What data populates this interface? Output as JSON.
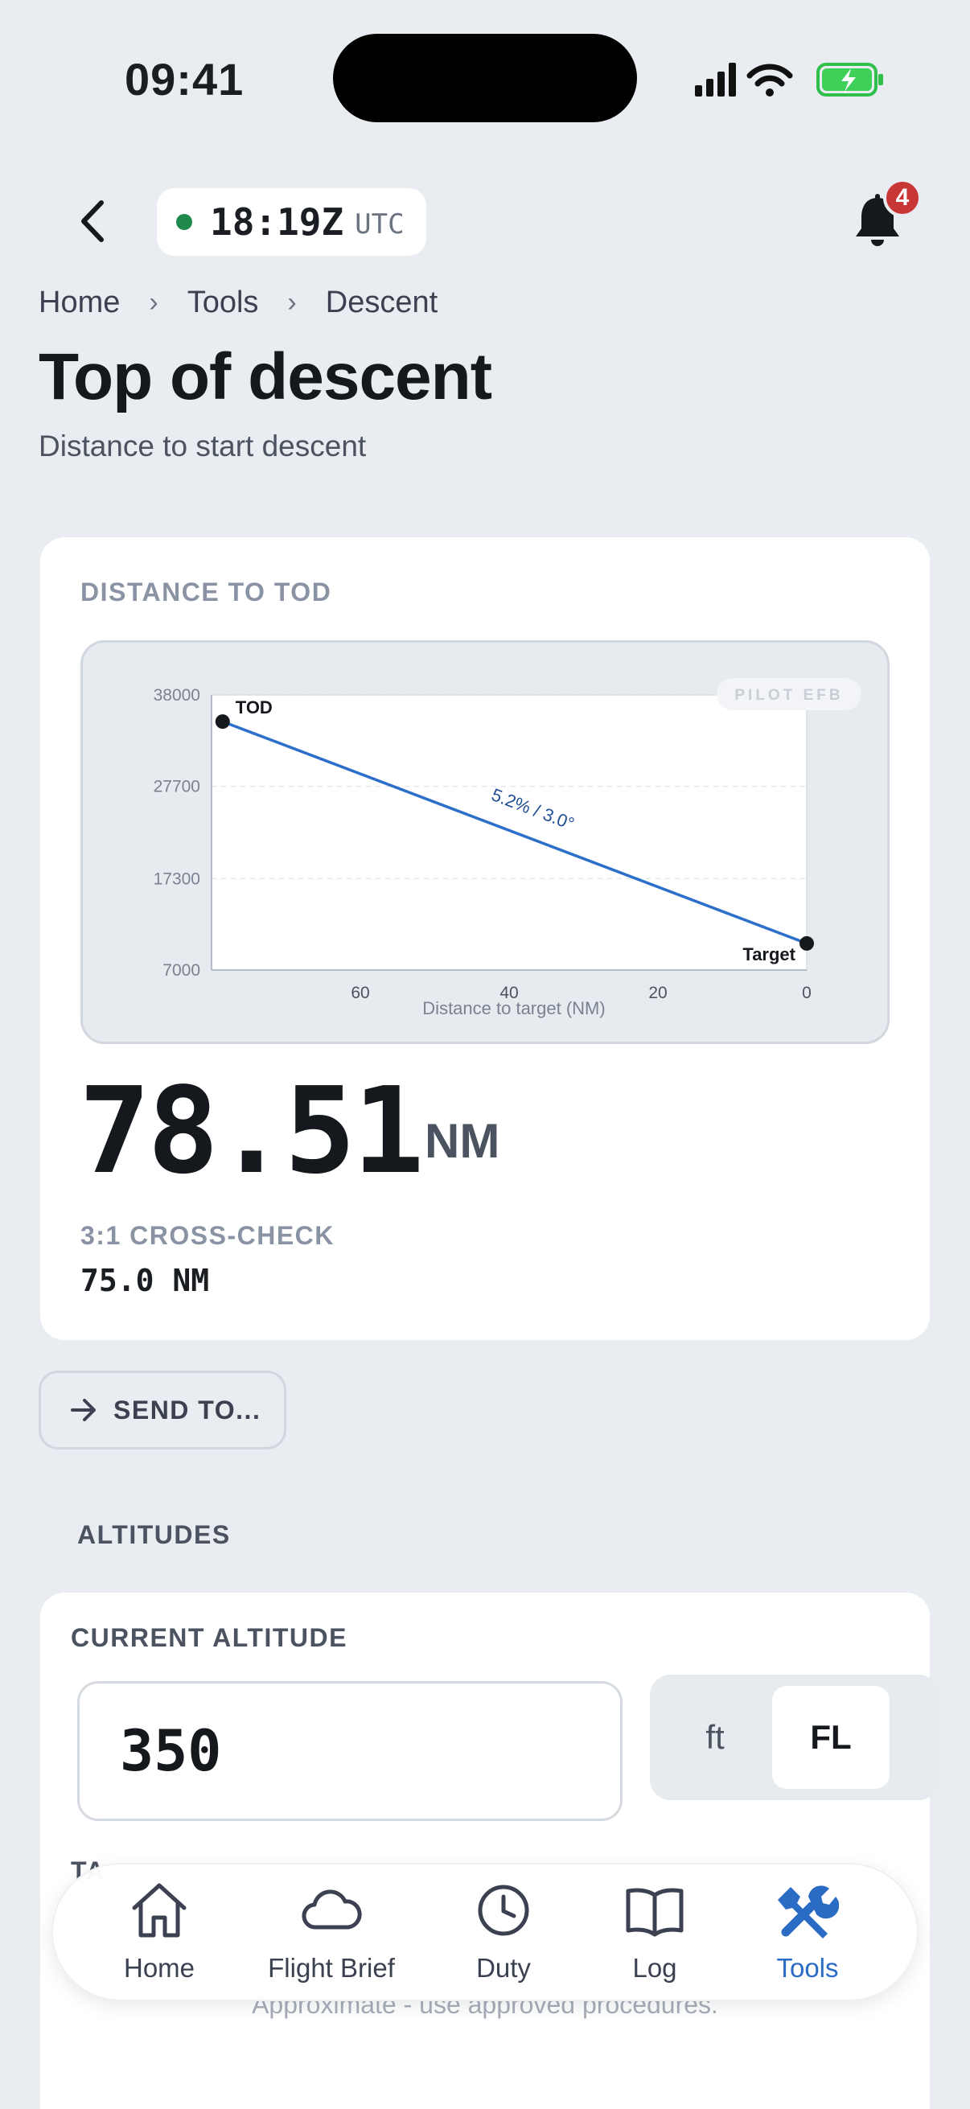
{
  "status_bar": {
    "time": "09:41"
  },
  "top_bar": {
    "utc_time": "18:19Z",
    "utc_label": "UTC",
    "notification_count": "4"
  },
  "breadcrumb": [
    "Home",
    "Tools",
    "Descent"
  ],
  "page": {
    "title": "Top of descent",
    "subtitle": "Distance to start descent"
  },
  "result": {
    "label": "DISTANCE TO TOD",
    "value": "78.51",
    "unit": "NM",
    "cross_check_label": "3:1 CROSS-CHECK",
    "cross_check_value": "75.0 NM"
  },
  "chart_data": {
    "type": "line",
    "xlabel": "Distance to target (NM)",
    "ylabel": "",
    "x_ticks": [
      60,
      40,
      20,
      0
    ],
    "y_ticks": [
      38000,
      27700,
      17300,
      7000
    ],
    "xlim": [
      80,
      0
    ],
    "ylim": [
      7000,
      38000
    ],
    "series": [
      {
        "name": "",
        "x": [
          78.51,
          0
        ],
        "y": [
          35000,
          10000
        ]
      }
    ],
    "point_labels": [
      "TOD",
      "Target"
    ],
    "slope_annotation": "5.2% / 3.0°",
    "watermark": "PILOT EFB",
    "grid": true,
    "line_color": "#2c6fc9"
  },
  "send_button": {
    "label": "SEND TO..."
  },
  "altitudes": {
    "section_label": "ALTITUDES",
    "current_label": "CURRENT ALTITUDE",
    "current_value": "350",
    "unit_options": [
      "ft",
      "FL"
    ],
    "selected_unit": "FL",
    "next_label_partial": "TA"
  },
  "footnote": "Approximate - use approved procedures.",
  "nav": {
    "items": [
      {
        "label": "Home",
        "icon": "home-icon"
      },
      {
        "label": "Flight Brief",
        "icon": "cloud-icon"
      },
      {
        "label": "Duty",
        "icon": "clock-icon"
      },
      {
        "label": "Log",
        "icon": "book-icon"
      },
      {
        "label": "Tools",
        "icon": "tools-icon",
        "active": true
      }
    ]
  },
  "colors": {
    "accent": "#2a6bc4",
    "background": "#e9ecf1",
    "status_green": "#1f8a4c",
    "badge_red": "#c93636"
  }
}
